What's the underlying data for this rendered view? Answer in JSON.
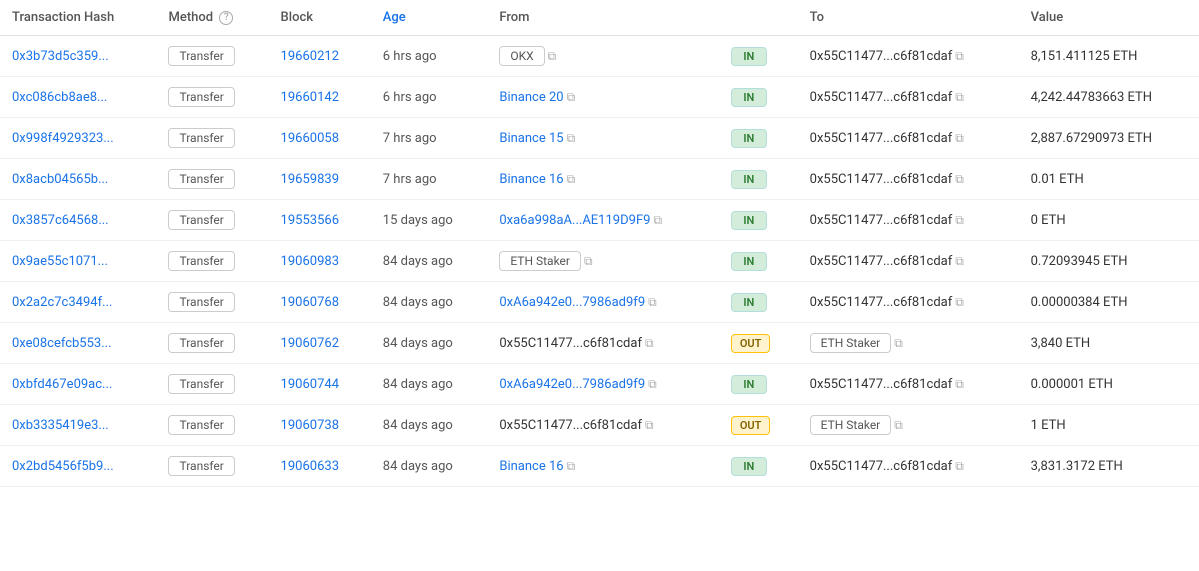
{
  "table": {
    "columns": [
      {
        "id": "tx_hash",
        "label": "Transaction Hash"
      },
      {
        "id": "method",
        "label": "Method",
        "has_info": true
      },
      {
        "id": "block",
        "label": "Block"
      },
      {
        "id": "age",
        "label": "Age",
        "is_active": true
      },
      {
        "id": "from",
        "label": "From"
      },
      {
        "id": "direction",
        "label": ""
      },
      {
        "id": "to",
        "label": "To"
      },
      {
        "id": "value",
        "label": "Value"
      }
    ],
    "rows": [
      {
        "tx_hash": "0x3b73d5c359...",
        "method": "Transfer",
        "block": "19660212",
        "age": "6 hrs ago",
        "from_text": "OKX",
        "from_type": "plain",
        "direction": "IN",
        "to_text": "0x55C11477...c6f81cdaf",
        "to_type": "plain",
        "value": "8,151.411125 ETH"
      },
      {
        "tx_hash": "0xc086cb8ae8...",
        "method": "Transfer",
        "block": "19660142",
        "age": "6 hrs ago",
        "from_text": "Binance 20",
        "from_type": "link",
        "direction": "IN",
        "to_text": "0x55C11477...c6f81cdaf",
        "to_type": "plain",
        "value": "4,242.44783663 ETH"
      },
      {
        "tx_hash": "0x998f4929323...",
        "method": "Transfer",
        "block": "19660058",
        "age": "7 hrs ago",
        "from_text": "Binance 15",
        "from_type": "link",
        "direction": "IN",
        "to_text": "0x55C11477...c6f81cdaf",
        "to_type": "plain",
        "value": "2,887.67290973 ETH"
      },
      {
        "tx_hash": "0x8acb04565b...",
        "method": "Transfer",
        "block": "19659839",
        "age": "7 hrs ago",
        "from_text": "Binance 16",
        "from_type": "link",
        "direction": "IN",
        "to_text": "0x55C11477...c6f81cdaf",
        "to_type": "plain",
        "value": "0.01 ETH"
      },
      {
        "tx_hash": "0x3857c64568...",
        "method": "Transfer",
        "block": "19553566",
        "age": "15 days ago",
        "from_text": "0xa6a998aA...AE119D9F9",
        "from_type": "link",
        "direction": "IN",
        "to_text": "0x55C11477...c6f81cdaf",
        "to_type": "plain",
        "value": "0 ETH"
      },
      {
        "tx_hash": "0x9ae55c1071...",
        "method": "Transfer",
        "block": "19060983",
        "age": "84 days ago",
        "from_text": "ETH Staker",
        "from_type": "plain",
        "direction": "IN",
        "to_text": "0x55C11477...c6f81cdaf",
        "to_type": "plain",
        "value": "0.72093945 ETH"
      },
      {
        "tx_hash": "0x2a2c7c3494f...",
        "method": "Transfer",
        "block": "19060768",
        "age": "84 days ago",
        "from_text": "0xA6a942e0...7986ad9f9",
        "from_type": "link",
        "direction": "IN",
        "to_text": "0x55C11477...c6f81cdaf",
        "to_type": "plain",
        "value": "0.00000384 ETH"
      },
      {
        "tx_hash": "0xe08cefcb553...",
        "method": "Transfer",
        "block": "19060762",
        "age": "84 days ago",
        "from_text": "0x55C11477...c6f81cdaf",
        "from_type": "plain",
        "direction": "OUT",
        "to_text": "ETH Staker",
        "to_type": "badge",
        "value": "3,840 ETH"
      },
      {
        "tx_hash": "0xbfd467e09ac...",
        "method": "Transfer",
        "block": "19060744",
        "age": "84 days ago",
        "from_text": "0xA6a942e0...7986ad9f9",
        "from_type": "link",
        "direction": "IN",
        "to_text": "0x55C11477...c6f81cdaf",
        "to_type": "plain",
        "value": "0.000001 ETH"
      },
      {
        "tx_hash": "0xb3335419e3...",
        "method": "Transfer",
        "block": "19060738",
        "age": "84 days ago",
        "from_text": "0x55C11477...c6f81cdaf",
        "from_type": "plain",
        "direction": "OUT",
        "to_text": "ETH Staker",
        "to_type": "badge",
        "value": "1 ETH"
      },
      {
        "tx_hash": "0x2bd5456f5b9...",
        "method": "Transfer",
        "block": "19060633",
        "age": "84 days ago",
        "from_text": "Binance 16",
        "from_type": "link",
        "direction": "IN",
        "to_text": "0x55C11477...c6f81cdaf",
        "to_type": "plain",
        "value": "3,831.3172 ETH"
      }
    ]
  },
  "icons": {
    "copy": "⧉",
    "info": "?"
  }
}
